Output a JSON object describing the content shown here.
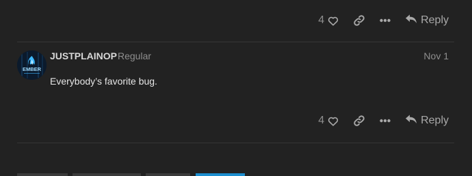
{
  "post1": {
    "like_count": "4",
    "reply_label": "Reply"
  },
  "post2": {
    "avatar": "ember-logo-avatar",
    "avatar_text": "EMBER",
    "username": "JUSTPLAINOP",
    "user_title": "Regular",
    "date": "Nov 1",
    "body": "Everybody’s favorite bug.",
    "like_count": "4",
    "reply_label": "Reply"
  },
  "icons": {
    "like": "heart-icon",
    "share": "link-icon",
    "more": "ellipsis-icon",
    "reply": "reply-arrow-icon"
  },
  "colors": {
    "background": "#222222",
    "muted_text": "#8f8f8f",
    "accent": "#1c8ecf"
  }
}
